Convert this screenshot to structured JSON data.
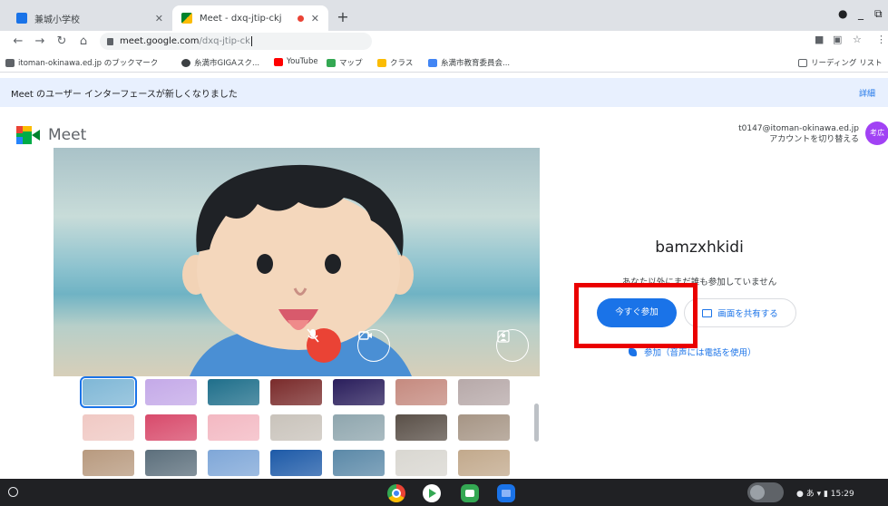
{
  "browser": {
    "tabs": [
      {
        "title": "兼城小学校",
        "active": false
      },
      {
        "title": "Meet - dxq-jtip-ckj",
        "active": true
      }
    ],
    "new_tab": "+",
    "window_controls": [
      "●",
      "_",
      "⧉"
    ],
    "url_host": "meet.google.com",
    "url_path": "/dxq-jtip-ck",
    "bookmarks": [
      {
        "label": "itoman-okinawa.ed.jp のブックマーク",
        "icon": "folder-icon"
      },
      {
        "label": "糸満市GIGAスク...",
        "icon": "link-icon"
      },
      {
        "label": "YouTube",
        "icon": "youtube-icon"
      },
      {
        "label": "マップ",
        "icon": "maps-icon"
      },
      {
        "label": "クラス",
        "icon": "classroom-icon"
      },
      {
        "label": "糸満市教育委員会...",
        "icon": "site-icon"
      }
    ],
    "reading_list": "リーディング リスト"
  },
  "banner": {
    "text": "Meet のユーザー インターフェースが新しくなりました",
    "link": "詳細"
  },
  "meet": {
    "logo_text": "Meet",
    "account_email": "t0147@itoman-okinawa.ed.jp",
    "switch_account": "アカウントを切り替える",
    "avatar_initials": "考広",
    "meeting_name": "bamzxhkidi",
    "presence_text": "あなた以外にまだ誰も参加していません",
    "join_now": "今すぐ参加",
    "present": "画面を共有する",
    "join_by_phone": "参加（音声には電話を使用）"
  },
  "backgrounds": {
    "thumbnail_count": 21,
    "colors": [
      "#7fb7d6",
      "#c4a9e8",
      "#1f6f8b",
      "#7a2b2b",
      "#2a1e5c",
      "#c58a7f",
      "#b7a9a9",
      "#f0c9c4",
      "#d84a6b",
      "#f3b8c2",
      "#c9c3bb",
      "#8fa6ae",
      "#5a5048",
      "#a69585",
      "#b89a7f",
      "#5c6f7c",
      "#7fa7d8",
      "#1d5aa8",
      "#5b89a8",
      "#d9d7d1",
      "#c2a98c"
    ]
  },
  "shelf": {
    "apps": [
      "chrome-icon",
      "play-store-icon",
      "meet-app-icon",
      "files-icon"
    ],
    "status_text": "● あ ▾ ▮ 15:29"
  },
  "colors": {
    "accent": "#1a73e8",
    "mic_off": "#ea4335",
    "highlight": "#ea0000"
  }
}
